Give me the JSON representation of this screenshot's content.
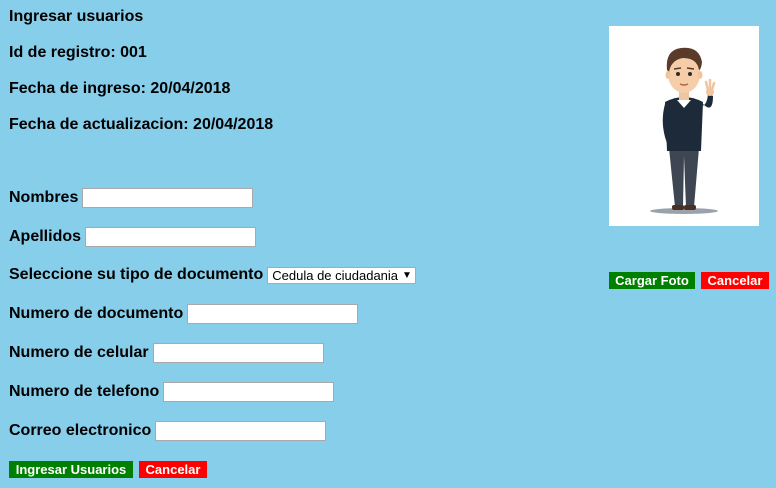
{
  "header": {
    "title": "Ingresar usuarios",
    "id_label": "Id de registro: 001",
    "fecha_ingreso": "Fecha de ingreso: 20/04/2018",
    "fecha_actualizacion": "Fecha de actualizacion: 20/04/2018"
  },
  "form": {
    "nombres_label": "Nombres",
    "nombres_value": "",
    "apellidos_label": "Apellidos",
    "apellidos_value": "",
    "tipo_documento_label": "Seleccione su tipo de documento",
    "tipo_documento_selected": "Cedula de ciudadania",
    "numero_documento_label": "Numero de documento",
    "numero_documento_value": "",
    "numero_celular_label": "Numero de celular",
    "numero_celular_value": "",
    "numero_telefono_label": "Numero de telefono",
    "numero_telefono_value": "",
    "correo_label": "Correo electronico",
    "correo_value": ""
  },
  "actions": {
    "ingresar_label": "Ingresar Usuarios",
    "cancelar_label": "Cancelar"
  },
  "photo": {
    "cargar_label": "Cargar Foto",
    "cancelar_label": "Cancelar"
  },
  "colors": {
    "background": "#87ceeb",
    "primary_button": "#008000",
    "cancel_button": "#ff0000"
  }
}
